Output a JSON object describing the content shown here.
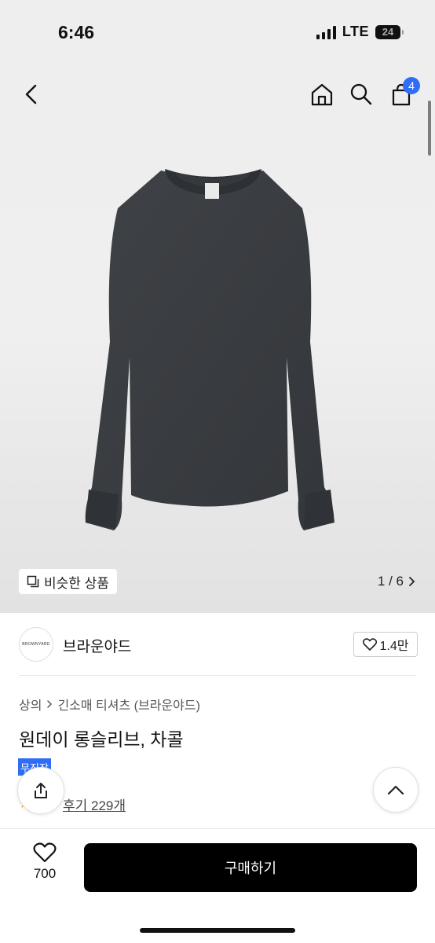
{
  "status_bar": {
    "time": "6:46",
    "network": "LTE",
    "battery": "24"
  },
  "header": {
    "cart_count": "4"
  },
  "gallery": {
    "similar_label": "비슷한 상품",
    "pager": "1 / 6"
  },
  "brand": {
    "logo_text": "BROWNYARD",
    "name": "브라운야드",
    "likes": "1.4만"
  },
  "product": {
    "breadcrumb": [
      "상의",
      "긴소매 티셔츠 (브라운야드)"
    ],
    "title": "원데이 롱슬리브, 차콜",
    "tag": "무진장",
    "reviews": "후기 229개"
  },
  "bottom_bar": {
    "wish_count": "700",
    "buy_label": "구매하기"
  },
  "colors": {
    "accent": "#2f6df6",
    "shirt": "#3b3e42",
    "buy_button": "#000000"
  },
  "icons": [
    "back-icon",
    "home-icon",
    "search-icon",
    "cart-icon",
    "copy-icon",
    "chevron-right-icon",
    "heart-icon",
    "share-icon",
    "chevron-up-icon",
    "star-icon"
  ]
}
